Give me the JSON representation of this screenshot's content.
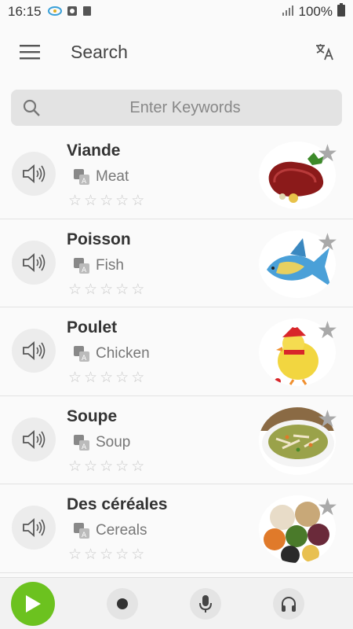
{
  "status_bar": {
    "time": "16:15",
    "battery": "100%"
  },
  "app_bar": {
    "title": "Search"
  },
  "search": {
    "placeholder": "Enter Keywords"
  },
  "items": [
    {
      "word": "Viande",
      "translation": "Meat",
      "image": "meat-image"
    },
    {
      "word": "Poisson",
      "translation": "Fish",
      "image": "fish-image"
    },
    {
      "word": "Poulet",
      "translation": "Chicken",
      "image": "chicken-image"
    },
    {
      "word": "Soupe",
      "translation": "Soup",
      "image": "soup-image"
    },
    {
      "word": "Des céréales",
      "translation": "Cereals",
      "image": "cereals-image"
    }
  ],
  "rating": {
    "max_stars": 5,
    "filled": 0
  },
  "colors": {
    "accent_play": "#6cc21f",
    "favorite_star": "#a9a9a9"
  }
}
